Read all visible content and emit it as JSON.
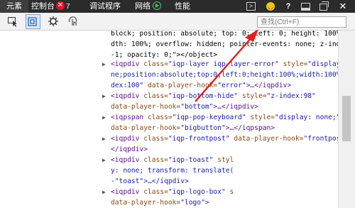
{
  "tabs": [
    {
      "label": "元素"
    },
    {
      "label": "控制台",
      "badge": "✕",
      "count": "7"
    },
    {
      "label": "调试程序"
    },
    {
      "label": "网络"
    },
    {
      "label": "性能"
    }
  ],
  "toolbar_right": {
    "help": "?",
    "close": "✕"
  },
  "search": {
    "placeholder": "查找(Ctrl+F)"
  },
  "code": {
    "l1": "block; position: absolute; top: 0; left: 0; height: 100%; wi",
    "l2": "dth: 100%; overflow: hidden; pointer-events: none; z-index:",
    "l3": "-1; opacity: 0;\"></object>",
    "l4_open": "<iqpdiv ",
    "l4_a1": "class=",
    "l4_v1": "\"iqp-layer iqp-layer-error\"",
    "l4_a2": " style=",
    "l4_v2": "\"display:no",
    "l5": "ne;position:absolute;top:0;left:0;height:100%;width:100%;z-in",
    "l6_v": "dex:100\"",
    "l6_a": " data-player-hook=",
    "l6_v2": "\"error\"",
    "l6_t": ">…</iqpdiv>",
    "l7_open": "<iqpdiv ",
    "l7_a1": "class=",
    "l7_v1": "\"iqp-bottom-hide\"",
    "l7_a2": " style=",
    "l7_v2": "\"z-index:98\"",
    "l8_a": "data-player-hook=",
    "l8_v": "\"bottom\"",
    "l8_t": ">…</iqpdiv>",
    "l9_open": "<iqpspan ",
    "l9_a1": "class=",
    "l9_v1": "\"iqp-pop-keyboard\"",
    "l9_a2": " style=",
    "l9_v2": "\"display: none;\"",
    "l10_a": "data-player-hook=",
    "l10_v": "\"bigbutton\"",
    "l10_t": ">…</iqpspan>",
    "l11_open": "<iqpdiv ",
    "l11_a1": "class=",
    "l11_v1": "\"iqp-frontpost\"",
    "l11_a2": " data-player-hook=",
    "l11_v2": "\"frontpost\"",
    "l11_t": ">…",
    "l12": "</iqpdiv>",
    "l13_open": "<iqpdiv ",
    "l13_a1": "class=",
    "l13_v1": "\"iqp-toast\"",
    "l13_a2": " styl",
    "l14": "y: none; transform: translate(",
    "l15": "-\"toast\">…</iqpdiv>",
    "l16_open": "<iqpdiv ",
    "l16_a1": "class=",
    "l16_v1": "\"iqp-logo-box\"",
    "l16_a2": " s",
    "l17_a": "data-player-hook=",
    "l17_v": "\"logo\"",
    "l17_t": ">"
  },
  "colors": {
    "tag": "#5c0f8b",
    "attr": "#8a4a14",
    "value": "#1a1aa6",
    "arrow": "#e02020"
  }
}
